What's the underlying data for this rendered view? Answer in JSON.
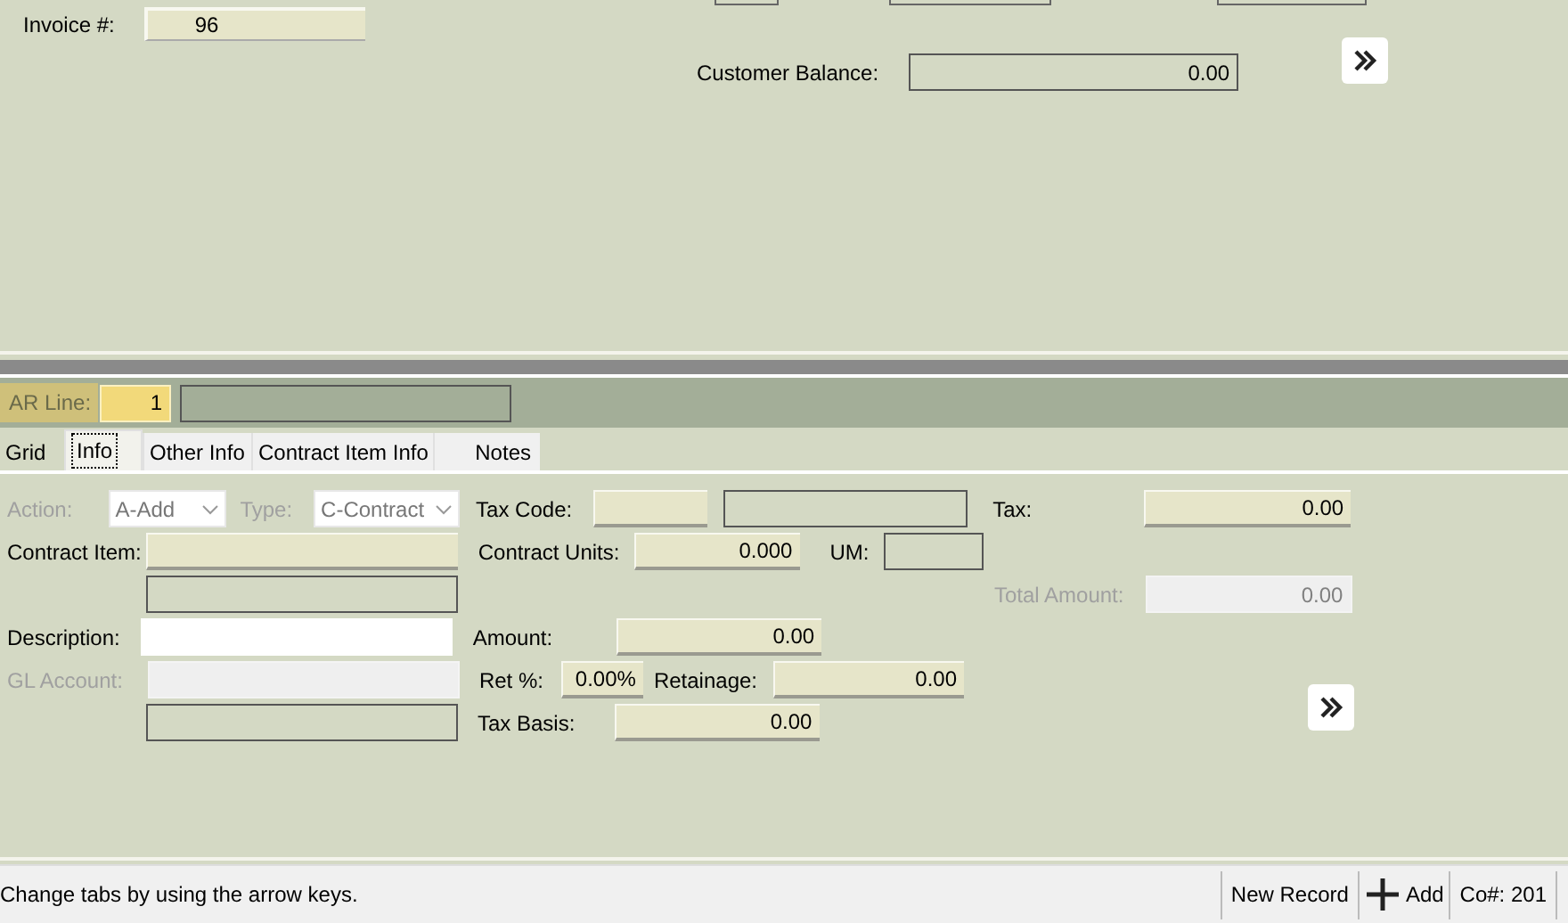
{
  "header": {
    "invoice": {
      "label": "Invoice #:",
      "value": "96"
    },
    "customer_balance": {
      "label": "Customer Balance:",
      "value": "0.00"
    }
  },
  "ar_line": {
    "label": "AR Line:",
    "value": "1",
    "highlighted": true
  },
  "tabs": [
    {
      "label": "Grid",
      "selected": false
    },
    {
      "label": "Info",
      "selected": true
    },
    {
      "label": "Other Info",
      "selected": false
    },
    {
      "label": "Contract Item Info",
      "selected": false
    },
    {
      "label": "Notes",
      "selected": false
    }
  ],
  "fields": {
    "action": {
      "label": "Action:",
      "value": "A-Add",
      "kind": "select",
      "disabled": true
    },
    "type": {
      "label": "Type:",
      "value": "C-Contract",
      "kind": "select",
      "disabled": true
    },
    "tax_code": {
      "label": "Tax Code:",
      "kind": "input",
      "disabled": false
    },
    "tax": {
      "label": "Tax:",
      "value": "0.00",
      "kind": "input",
      "disabled": false
    },
    "contract_item": {
      "label": "Contract Item:",
      "kind": "input",
      "disabled": false
    },
    "contract_units": {
      "label": "Contract Units:",
      "value": "0.000",
      "kind": "input",
      "disabled": false
    },
    "um": {
      "label": "UM:",
      "kind": "readonly",
      "disabled": false
    },
    "total_amount": {
      "label": "Total Amount:",
      "value": "0.00",
      "kind": "input",
      "disabled": true
    },
    "description": {
      "label": "Description:",
      "kind": "blank",
      "disabled": false
    },
    "amount": {
      "label": "Amount:",
      "value": "0.00",
      "kind": "input",
      "disabled": false
    },
    "gl_account": {
      "label": "GL Account:",
      "kind": "input",
      "disabled": true
    },
    "ret_pct": {
      "label": "Ret %:",
      "value": "0.00%",
      "kind": "input",
      "disabled": false
    },
    "retainage": {
      "label": "Retainage:",
      "value": "0.00",
      "kind": "input",
      "disabled": false
    },
    "tax_basis": {
      "label": "Tax Basis:",
      "value": "0.00",
      "kind": "input",
      "disabled": false
    }
  },
  "status_bar": {
    "message": "Change tabs by using the arrow keys.",
    "new_record": "New Record",
    "add": "Add",
    "company": "Co#: 201"
  }
}
